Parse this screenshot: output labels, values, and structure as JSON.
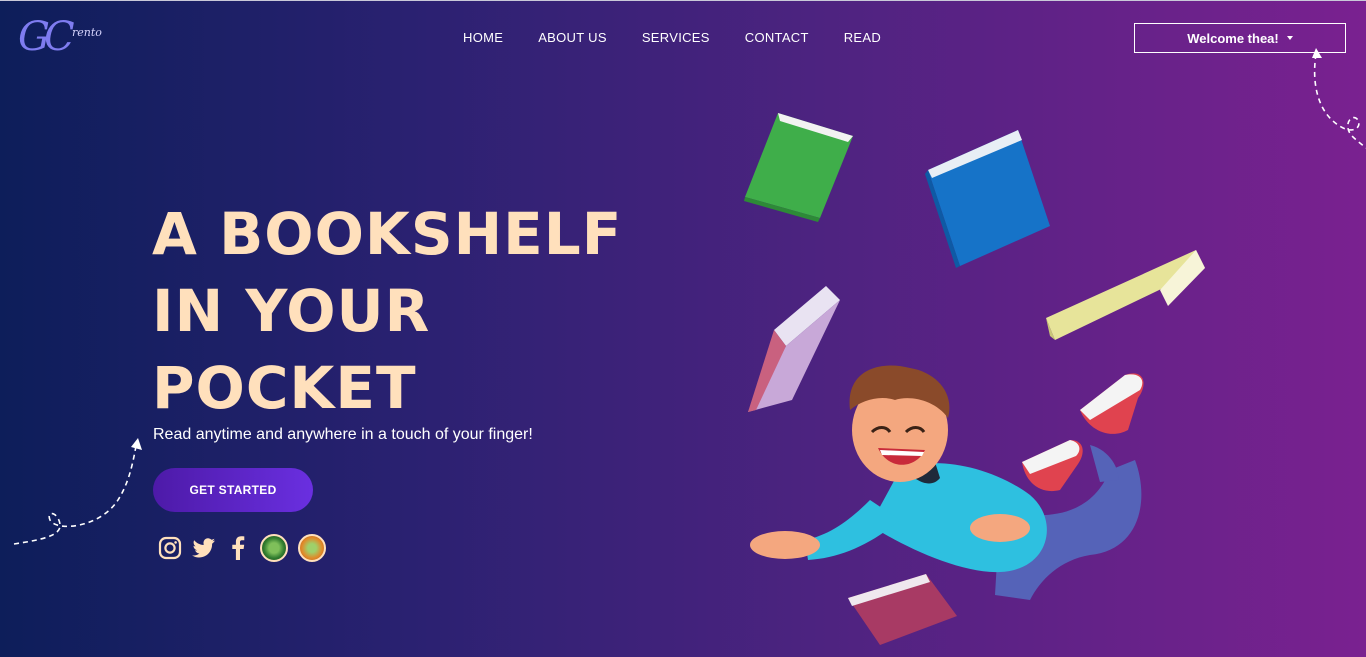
{
  "brand": {
    "logo_initials": "GC",
    "logo_word": "rento"
  },
  "nav": {
    "items": [
      "HOME",
      "ABOUT US",
      "SERVICES",
      "CONTACT",
      "READ"
    ]
  },
  "user_menu": {
    "label": "Welcome thea!"
  },
  "hero": {
    "title_lines": [
      "A BOOKSHELF",
      "IN YOUR",
      "POCKET"
    ],
    "tagline": "Read anytime and anywhere in a touch of your finger!",
    "cta_label": "GET STARTED"
  },
  "socials": [
    "instagram-icon",
    "twitter-icon",
    "facebook-icon",
    "school-seal-icon",
    "college-seal-icon"
  ],
  "colors": {
    "title": "#ffe0bc",
    "cta": "#5b22c8",
    "bg_left": "#0d1e5a",
    "bg_right": "#7a2190"
  }
}
